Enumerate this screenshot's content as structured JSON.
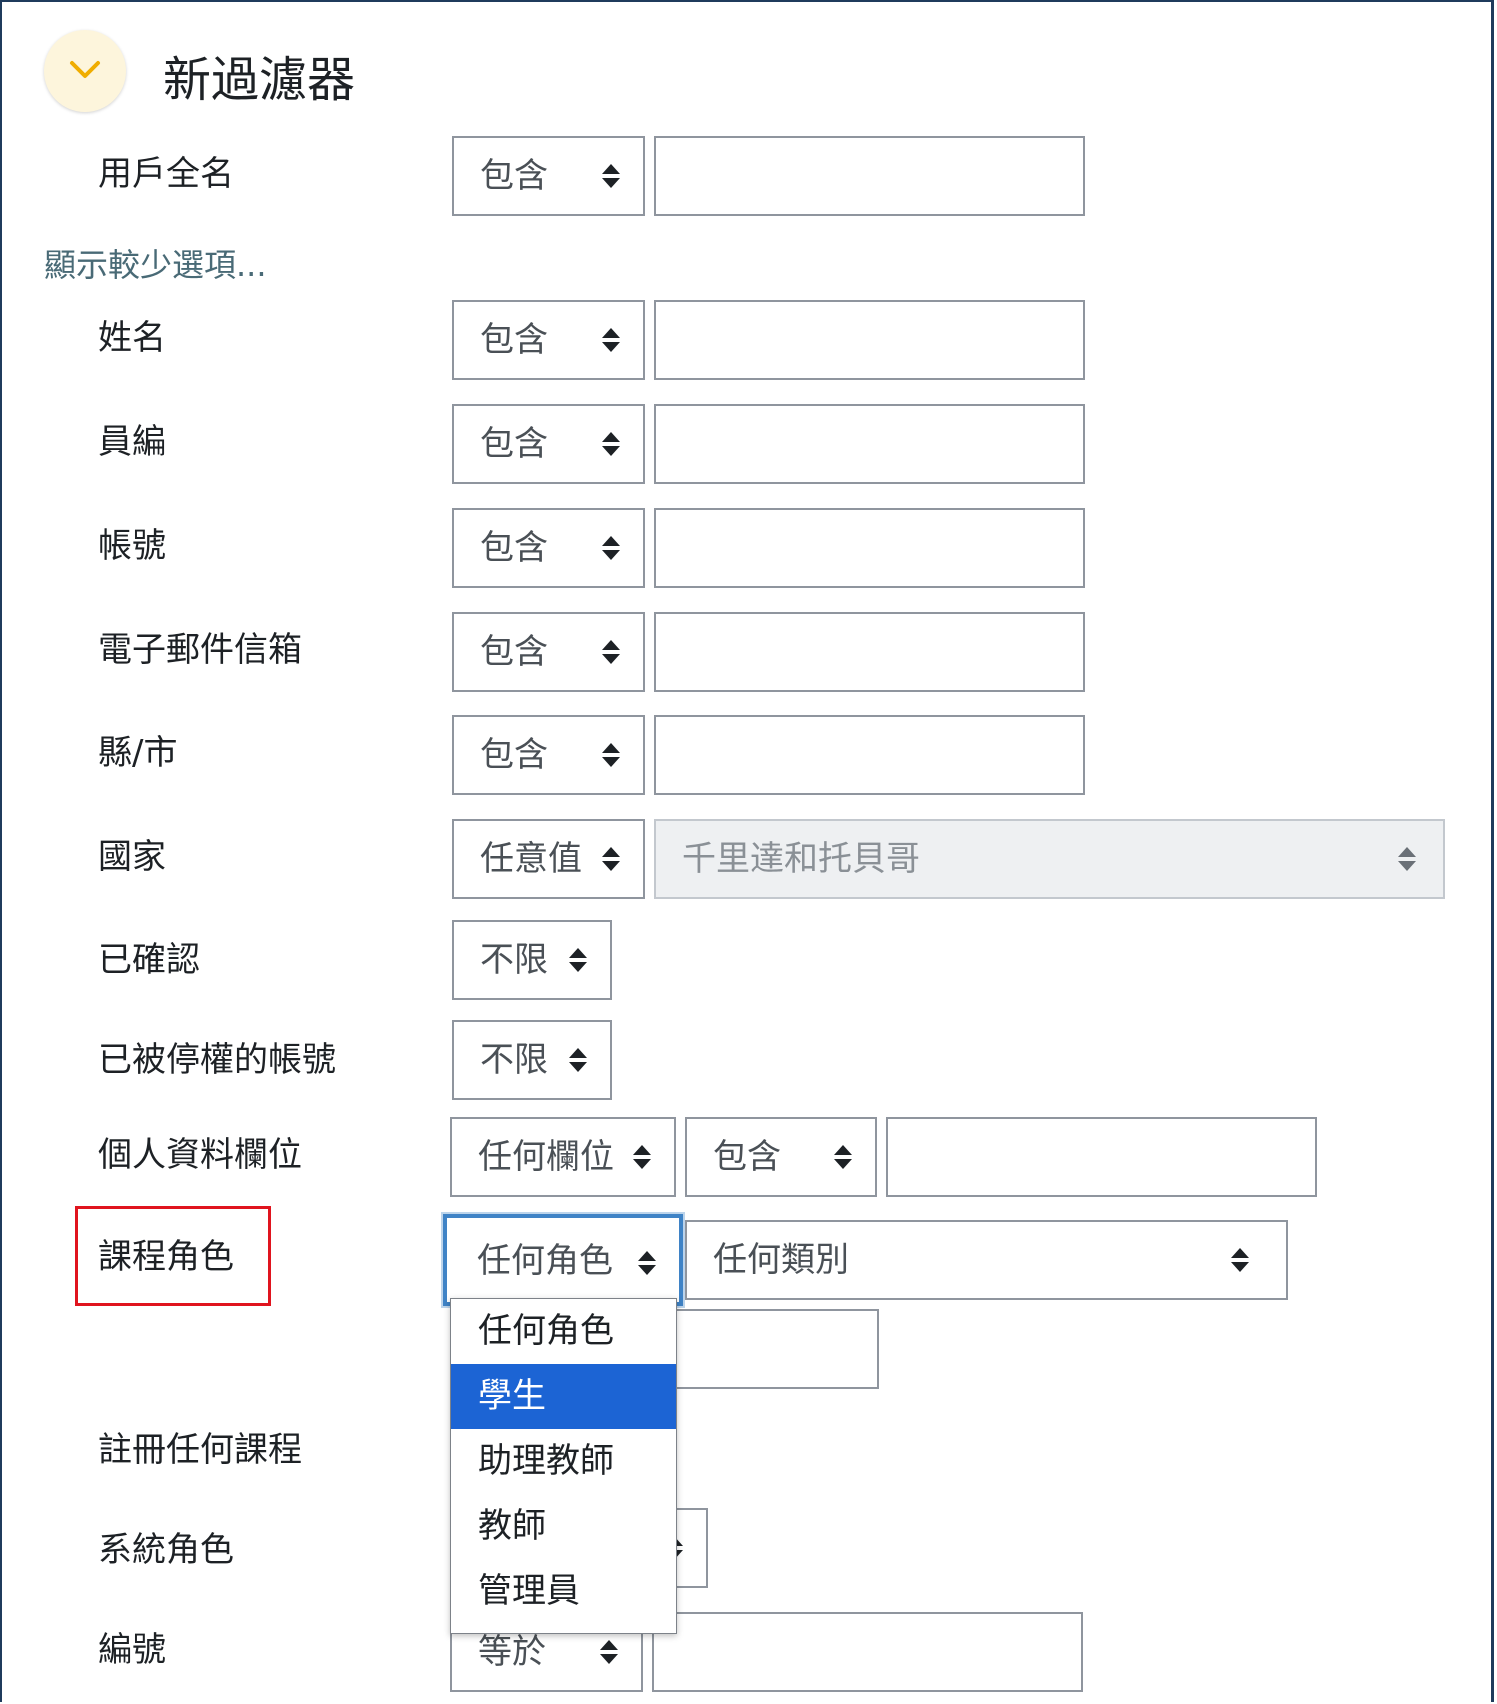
{
  "header": {
    "title": "新過濾器",
    "toggle_icon": "chevron-down-icon",
    "toggle_color": "#fdf5dc"
  },
  "show_less_link": "顯示較少選項...",
  "fields": {
    "fullname": {
      "label": "用戶全名",
      "operator": "包含",
      "value": ""
    },
    "lastname": {
      "label": "姓名",
      "operator": "包含",
      "value": ""
    },
    "idnumber": {
      "label": "員編",
      "operator": "包含",
      "value": ""
    },
    "username": {
      "label": "帳號",
      "operator": "包含",
      "value": ""
    },
    "email": {
      "label": "電子郵件信箱",
      "operator": "包含",
      "value": ""
    },
    "city": {
      "label": "縣/市",
      "operator": "包含",
      "value": ""
    },
    "country": {
      "label": "國家",
      "operator": "任意值",
      "value": "千里達和托貝哥"
    },
    "confirmed": {
      "label": "已確認",
      "operator": "不限"
    },
    "suspended": {
      "label": "已被停權的帳號",
      "operator": "不限"
    },
    "profile": {
      "label": "個人資料欄位",
      "field": "任何欄位",
      "operator": "包含",
      "value": ""
    },
    "course_role": {
      "label": "課程角色",
      "role": "任何角色",
      "category": "任何類別"
    },
    "any_course": {
      "label": "註冊任何課程"
    },
    "system_role": {
      "label": "系統角色"
    },
    "id": {
      "label": "編號",
      "operator": "等於",
      "value": ""
    }
  },
  "role_dropdown": {
    "options": [
      "任何角色",
      "學生",
      "助理教師",
      "教師",
      "管理員"
    ],
    "highlighted": "學生"
  },
  "colors": {
    "highlight": "#1c64d4",
    "annotation": "#e0141e",
    "focus": "#3f83c6",
    "link": "#496a76"
  }
}
